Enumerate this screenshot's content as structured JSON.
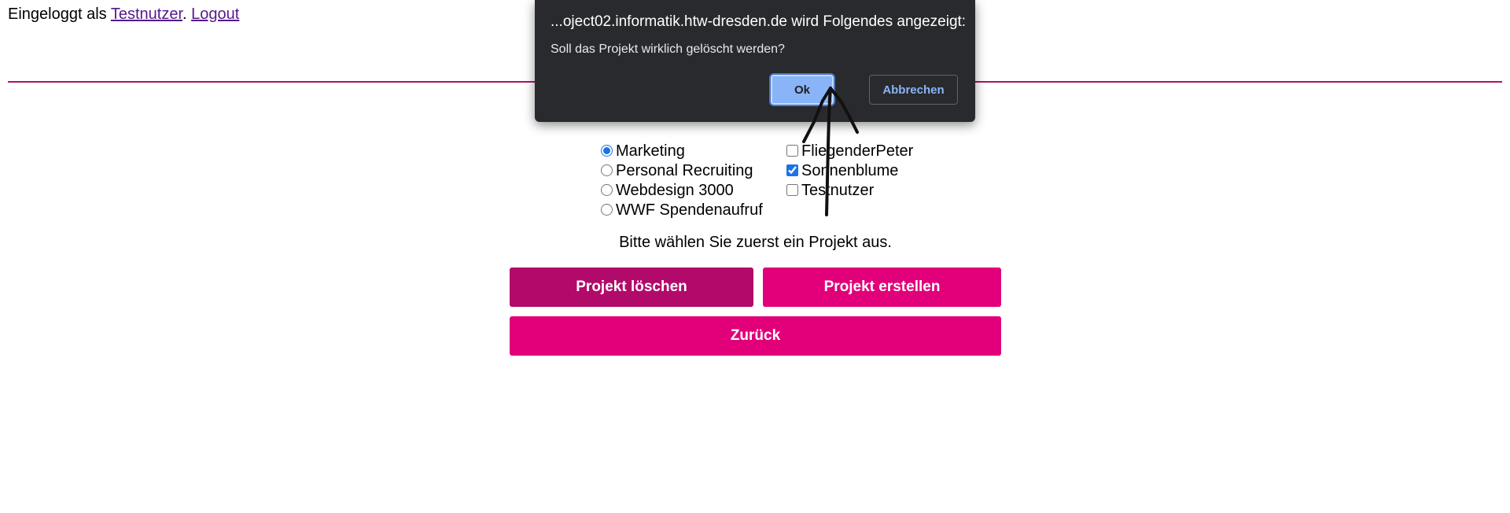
{
  "header": {
    "prefix": "Eingeloggt als ",
    "username": "Testnutzer",
    "separator": ". ",
    "logout": "Logout"
  },
  "projects": [
    {
      "label": "Marketing",
      "selected": true
    },
    {
      "label": "Personal Recruiting",
      "selected": false
    },
    {
      "label": "Webdesign 3000",
      "selected": false
    },
    {
      "label": "WWF Spendenaufruf",
      "selected": false
    }
  ],
  "users": [
    {
      "label": "FliegenderPeter",
      "checked": false
    },
    {
      "label": "Sonnenblume",
      "checked": true
    },
    {
      "label": "Testnutzer",
      "checked": false
    }
  ],
  "hint": "Bitte wählen Sie zuerst ein Projekt aus.",
  "buttons": {
    "delete": "Projekt löschen",
    "create": "Projekt erstellen",
    "back": "Zurück"
  },
  "dialog": {
    "title": "...oject02.informatik.htw-dresden.de wird Folgendes angezeigt:",
    "message": "Soll das Projekt wirklich gelöscht werden?",
    "ok": "Ok",
    "cancel": "Abbrechen"
  },
  "colors": {
    "accent": "#e2007a",
    "accent_dark": "#b10a6a",
    "dialog_bg": "#292a2d",
    "dialog_button": "#8ab4f8"
  }
}
